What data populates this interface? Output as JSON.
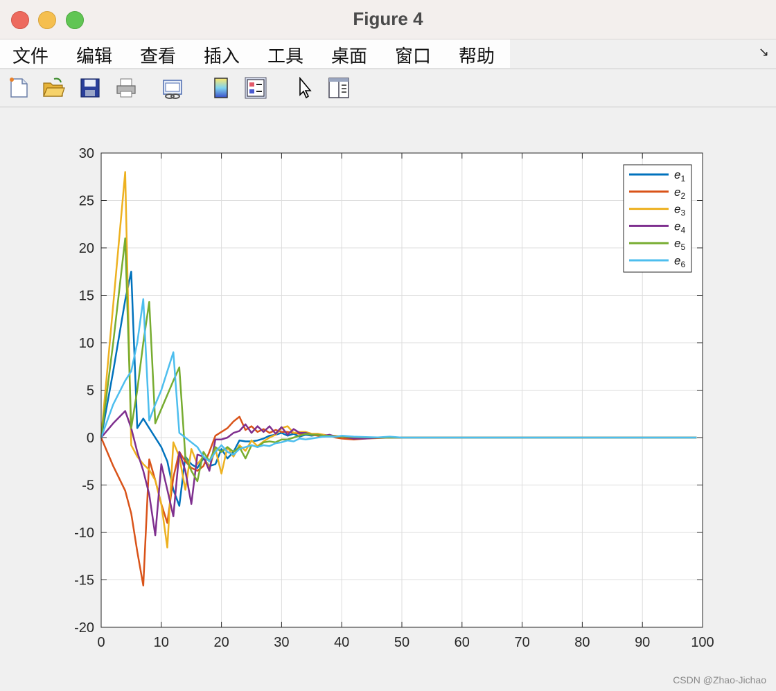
{
  "window": {
    "title": "Figure 4"
  },
  "menu": {
    "items": [
      "文件",
      "编辑",
      "查看",
      "插入",
      "工具",
      "桌面",
      "窗口",
      "帮助"
    ],
    "overflow_icon": "arrow-corner-icon"
  },
  "toolbar": {
    "icons": [
      "new-figure-icon",
      "open-file-icon",
      "save-icon",
      "print-icon",
      "link-plot-icon",
      "insert-colorbar-icon",
      "insert-legend-icon",
      "edit-plot-icon",
      "property-inspector-icon"
    ]
  },
  "colors": {
    "e1": "#0072BD",
    "e2": "#D95319",
    "e3": "#EDB120",
    "e4": "#7E2F8E",
    "e5": "#77AC30",
    "e6": "#4DBEEE"
  },
  "watermark": "CSDN @Zhao-Jichao",
  "chart_data": {
    "type": "line",
    "xlim": [
      0,
      100
    ],
    "ylim": [
      -20,
      30
    ],
    "xticks": [
      0,
      10,
      20,
      30,
      40,
      50,
      60,
      70,
      80,
      90,
      100
    ],
    "yticks": [
      -20,
      -15,
      -10,
      -5,
      0,
      5,
      10,
      15,
      20,
      25,
      30
    ],
    "grid": true,
    "legend_position": "top-right",
    "series": [
      {
        "name": "e1",
        "color": "#0072BD",
        "x": [
          0,
          2,
          4,
          5,
          6,
          7,
          8,
          9,
          10,
          11,
          12,
          13,
          14,
          15,
          16,
          17,
          18,
          19,
          20,
          21,
          22,
          23,
          24,
          25,
          26,
          27,
          28,
          29,
          30,
          31,
          32,
          33,
          34,
          35,
          36,
          37,
          38,
          39,
          40,
          42,
          44,
          46,
          48,
          50,
          55,
          60,
          70,
          80,
          90,
          99
        ],
        "y": [
          0,
          7,
          14.5,
          17.5,
          1,
          2,
          1,
          0,
          -1,
          -2.5,
          -5.5,
          -7.2,
          -2,
          -2.8,
          -3.2,
          -2.2,
          -3,
          -2.8,
          -1.2,
          -2.2,
          -1.5,
          -0.3,
          -0.4,
          -0.4,
          -0.3,
          -0.1,
          0.2,
          0.3,
          0.5,
          0.2,
          0.4,
          0.1,
          0.3,
          0.2,
          0.3,
          0.1,
          0.2,
          0.1,
          0.1,
          0.05,
          0.02,
          0.02,
          0,
          0,
          0,
          0,
          0,
          0,
          0,
          0
        ]
      },
      {
        "name": "e2",
        "color": "#D95319",
        "x": [
          0,
          2,
          4,
          5,
          6,
          7,
          8,
          9,
          10,
          11,
          12,
          13,
          14,
          15,
          16,
          17,
          18,
          19,
          20,
          21,
          22,
          23,
          24,
          25,
          26,
          27,
          28,
          29,
          30,
          31,
          32,
          33,
          34,
          35,
          36,
          37,
          38,
          39,
          40,
          42,
          44,
          46,
          48,
          50,
          55,
          60,
          70,
          80,
          90,
          99
        ],
        "y": [
          0,
          -3,
          -5.6,
          -8,
          -12,
          -15.6,
          -2.3,
          -4.5,
          -7,
          -9,
          -4.2,
          -1.5,
          -2.5,
          -3.2,
          -3.5,
          -3,
          -1.5,
          0.2,
          0.6,
          1,
          1.7,
          2.2,
          0.8,
          1.2,
          0.6,
          0.9,
          0.5,
          0.8,
          0.6,
          0.6,
          0.5,
          0.4,
          0.4,
          0.3,
          0.2,
          0.1,
          0.2,
          0,
          -0.1,
          -0.2,
          -0.1,
          -0.05,
          0,
          0,
          0,
          0,
          0,
          0,
          0,
          0
        ]
      },
      {
        "name": "e3",
        "color": "#EDB120",
        "x": [
          0,
          2,
          4,
          5,
          6,
          7,
          8,
          9,
          10,
          11,
          12,
          13,
          14,
          15,
          16,
          17,
          18,
          19,
          20,
          21,
          22,
          23,
          24,
          25,
          26,
          27,
          28,
          29,
          30,
          31,
          32,
          33,
          34,
          35,
          36,
          37,
          38,
          39,
          40,
          42,
          44,
          46,
          48,
          50,
          55,
          60,
          70,
          80,
          90,
          99
        ],
        "y": [
          0,
          14,
          28,
          -0.8,
          -2,
          -2.8,
          -3.4,
          -4.5,
          -7,
          -11.6,
          -0.5,
          -2,
          -5.5,
          -1.2,
          -2.8,
          -2,
          -3.2,
          -1.2,
          -3.8,
          -1,
          -2,
          -0.8,
          -1.4,
          -0.3,
          -0.9,
          -0.4,
          0,
          0.3,
          1,
          1.2,
          0.5,
          0.6,
          0.6,
          0.4,
          0.4,
          0.3,
          0.2,
          0.2,
          0.1,
          0.05,
          0.02,
          0,
          0,
          0,
          0,
          0,
          0,
          0,
          0,
          0
        ]
      },
      {
        "name": "e4",
        "color": "#7E2F8E",
        "x": [
          0,
          2,
          4,
          5,
          6,
          7,
          8,
          9,
          10,
          11,
          12,
          13,
          14,
          15,
          16,
          17,
          18,
          19,
          20,
          21,
          22,
          23,
          24,
          25,
          26,
          27,
          28,
          29,
          30,
          31,
          32,
          33,
          34,
          35,
          36,
          37,
          38,
          39,
          40,
          42,
          44,
          46,
          48,
          50,
          55,
          60,
          70,
          80,
          90,
          99
        ],
        "y": [
          0,
          1.5,
          2.8,
          1,
          -1.5,
          -3.5,
          -6,
          -10.3,
          -2.8,
          -5.5,
          -8.3,
          -1.5,
          -3.5,
          -7,
          -1.8,
          -2,
          -3.5,
          -0.2,
          -0.2,
          0,
          0.5,
          0.7,
          1.4,
          0.5,
          1.2,
          0.6,
          1.2,
          0.4,
          1.1,
          0.3,
          0.9,
          0.5,
          0.5,
          0.3,
          0.3,
          0.2,
          0.3,
          0.1,
          0.1,
          -0.1,
          -0.1,
          0,
          0,
          0,
          0,
          0,
          0,
          0,
          0,
          0
        ]
      },
      {
        "name": "e5",
        "color": "#77AC30",
        "x": [
          0,
          2,
          4,
          5,
          6,
          7,
          8,
          9,
          10,
          11,
          12,
          13,
          14,
          15,
          16,
          17,
          18,
          19,
          20,
          21,
          22,
          23,
          24,
          25,
          26,
          27,
          28,
          29,
          30,
          31,
          32,
          33,
          34,
          35,
          36,
          37,
          38,
          39,
          40,
          42,
          44,
          46,
          48,
          50,
          55,
          60,
          70,
          80,
          90,
          99
        ],
        "y": [
          0,
          10,
          21,
          1,
          5,
          10,
          14.3,
          1.5,
          3,
          4.5,
          6,
          7.4,
          -2,
          -3.5,
          -4.6,
          -1.5,
          -2.5,
          -1,
          -1.5,
          -1,
          -1.5,
          -1,
          -2.2,
          -0.8,
          -1,
          -0.5,
          -0.4,
          -0.5,
          -0.2,
          -0.2,
          0,
          0.2,
          0.4,
          0.3,
          0.3,
          0.2,
          0.2,
          0.1,
          0.1,
          0.05,
          0.02,
          0,
          0,
          0,
          0,
          0,
          0,
          0,
          0,
          0
        ]
      },
      {
        "name": "e6",
        "color": "#4DBEEE",
        "x": [
          0,
          2,
          4,
          5,
          6,
          7,
          8,
          9,
          10,
          11,
          12,
          13,
          14,
          15,
          16,
          17,
          18,
          19,
          20,
          21,
          22,
          23,
          24,
          25,
          26,
          27,
          28,
          29,
          30,
          31,
          32,
          33,
          34,
          35,
          36,
          37,
          38,
          39,
          40,
          42,
          44,
          46,
          48,
          50,
          55,
          60,
          70,
          80,
          90,
          99
        ],
        "y": [
          0,
          3.5,
          6,
          7,
          10,
          14.6,
          1.8,
          3.5,
          5,
          7,
          9,
          0.5,
          0,
          -0.5,
          -1,
          -2,
          -2.5,
          -1.5,
          -0.8,
          -1.5,
          -1.8,
          -1.2,
          -1,
          -0.8,
          -1,
          -0.8,
          -0.9,
          -0.6,
          -0.5,
          -0.3,
          -0.4,
          -0.1,
          -0.2,
          -0.1,
          0,
          0.1,
          0.1,
          0.1,
          0.2,
          0.1,
          0.05,
          0.02,
          0.1,
          0,
          0,
          0,
          0,
          0,
          0,
          0
        ]
      }
    ]
  }
}
